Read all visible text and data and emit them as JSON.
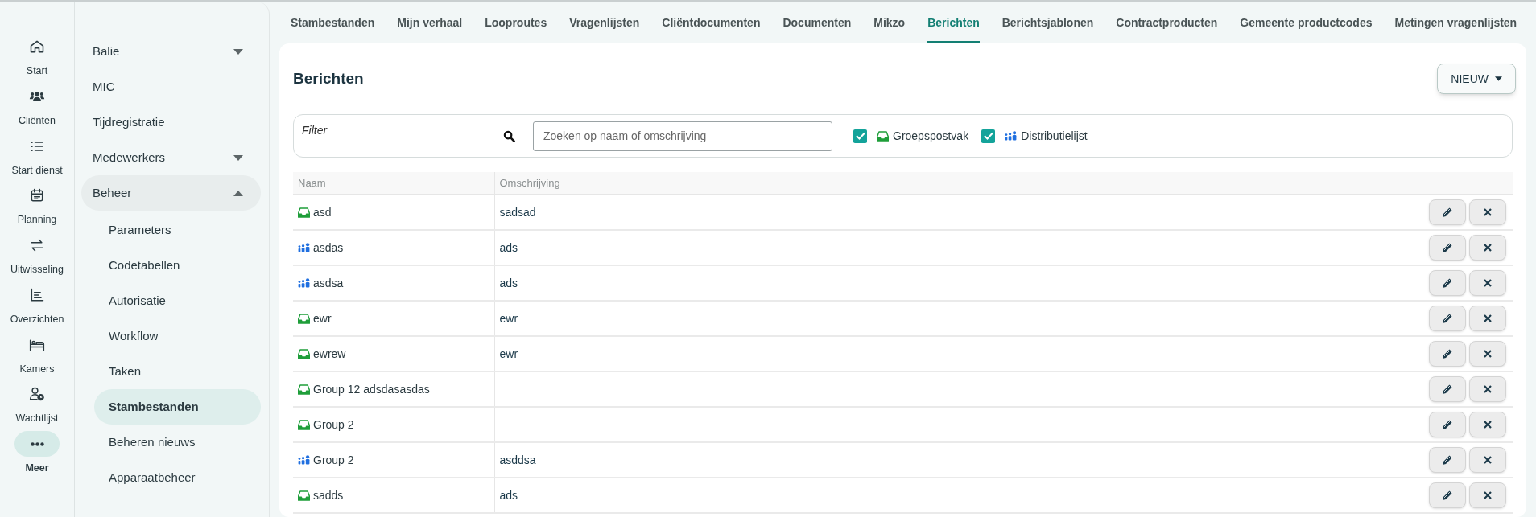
{
  "rail": [
    {
      "label": "Start",
      "selected": false
    },
    {
      "label": "Cliënten",
      "selected": false
    },
    {
      "label": "Start dienst",
      "selected": false
    },
    {
      "label": "Planning",
      "selected": false
    },
    {
      "label": "Uitwisseling",
      "selected": false
    },
    {
      "label": "Overzichten",
      "selected": false
    },
    {
      "label": "Kamers",
      "selected": false
    },
    {
      "label": "Wachtlijst",
      "selected": false
    },
    {
      "label": "Meer",
      "selected": true
    }
  ],
  "sidebar": {
    "items": [
      {
        "label": "Balie",
        "expanded": false
      },
      {
        "label": "MIC"
      },
      {
        "label": "Tijdregistratie"
      },
      {
        "label": "Medewerkers",
        "expanded": false
      },
      {
        "label": "Beheer",
        "expanded": true,
        "children": [
          {
            "label": "Parameters",
            "selected": false
          },
          {
            "label": "Codetabellen",
            "selected": false
          },
          {
            "label": "Autorisatie",
            "selected": false
          },
          {
            "label": "Workflow",
            "selected": false
          },
          {
            "label": "Taken",
            "selected": false
          },
          {
            "label": "Stambestanden",
            "selected": true
          },
          {
            "label": "Beheren nieuws",
            "selected": false
          },
          {
            "label": "Apparaatbeheer",
            "selected": false
          }
        ]
      }
    ]
  },
  "tabs": [
    {
      "label": "Stambestanden",
      "selected": false
    },
    {
      "label": "Mijn verhaal",
      "selected": false
    },
    {
      "label": "Looproutes",
      "selected": false
    },
    {
      "label": "Vragenlijsten",
      "selected": false
    },
    {
      "label": "Cliëntdocumenten",
      "selected": false
    },
    {
      "label": "Documenten",
      "selected": false
    },
    {
      "label": "Mikzo",
      "selected": false
    },
    {
      "label": "Berichten",
      "selected": true
    },
    {
      "label": "Berichtsjablonen",
      "selected": false
    },
    {
      "label": "Contractproducten",
      "selected": false
    },
    {
      "label": "Gemeente productcodes",
      "selected": false
    },
    {
      "label": "Metingen vragenlijsten",
      "selected": false
    }
  ],
  "page": {
    "title": "Berichten",
    "new_button": "NIEUW"
  },
  "filter": {
    "label": "Filter",
    "search": {
      "placeholder": "Zoeken op naam of omschrijving"
    },
    "options": [
      {
        "label": "Groepspostvak",
        "kind": "group_mailbox",
        "checked": true
      },
      {
        "label": "Distributielijst",
        "kind": "distribution_list",
        "checked": true
      }
    ]
  },
  "table": {
    "columns": [
      "Naam",
      "Omschrijving"
    ],
    "rows": [
      {
        "kind": "group_mailbox",
        "name": "asd",
        "description": "sadsad"
      },
      {
        "kind": "distribution_list",
        "name": "asdas",
        "description": "ads"
      },
      {
        "kind": "distribution_list",
        "name": "asdsa",
        "description": "ads"
      },
      {
        "kind": "group_mailbox",
        "name": "ewr",
        "description": "ewr"
      },
      {
        "kind": "group_mailbox",
        "name": "ewrew",
        "description": "ewr"
      },
      {
        "kind": "group_mailbox",
        "name": "Group 12 adsdasasdas",
        "description": ""
      },
      {
        "kind": "group_mailbox",
        "name": "Group 2",
        "description": ""
      },
      {
        "kind": "distribution_list",
        "name": "Group 2",
        "description": "asddsa"
      },
      {
        "kind": "group_mailbox",
        "name": "sadds",
        "description": "ads"
      }
    ]
  }
}
